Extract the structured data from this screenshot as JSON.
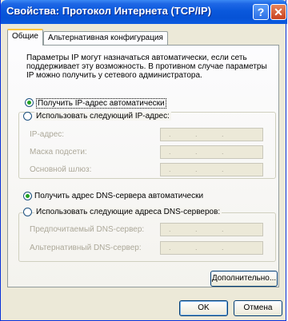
{
  "window": {
    "title": "Свойства: Протокол Интернета (TCP/IP)",
    "help_glyph": "?",
    "close_glyph": "✕"
  },
  "tabs": [
    {
      "label": "Общие",
      "active": true
    },
    {
      "label": "Альтернативная конфигурация",
      "active": false
    }
  ],
  "intro": "Параметры IP могут назначаться автоматически, если сеть поддерживает эту возможность. В противном случае параметры IP можно получить у сетевого администратора.",
  "ip": {
    "auto_label": "Получить IP-адрес автоматически",
    "manual_label": "Использовать следующий IP-адрес:",
    "selected": "auto",
    "fields": [
      {
        "label": "IP-адрес:",
        "value": ". . ."
      },
      {
        "label": "Маска подсети:",
        "value": ". . ."
      },
      {
        "label": "Основной шлюз:",
        "value": ". . ."
      }
    ]
  },
  "dns": {
    "auto_label": "Получить адрес DNS-сервера автоматически",
    "manual_label": "Использовать следующие адреса DNS-серверов:",
    "selected": "auto",
    "fields": [
      {
        "label": "Предпочитаемый DNS-сервер:",
        "value": ". . ."
      },
      {
        "label": "Альтернативный DNS-сервер:",
        "value": ". . ."
      }
    ]
  },
  "buttons": {
    "advanced": "Дополнительно...",
    "ok": "OK",
    "cancel": "Отмена"
  }
}
